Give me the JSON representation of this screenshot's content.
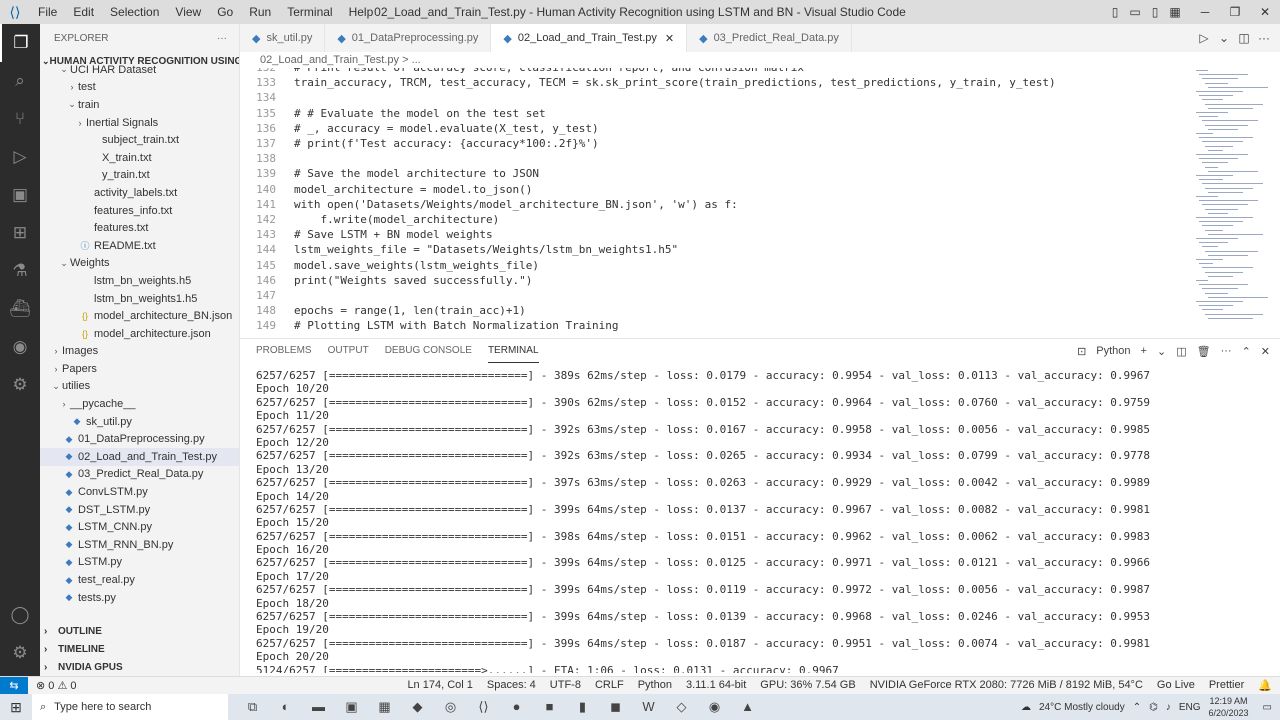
{
  "window": {
    "title": "02_Load_and_Train_Test.py - Human Activity Recognition using LSTM and BN - Visual Studio Code",
    "menu": [
      "File",
      "Edit",
      "Selection",
      "View",
      "Go",
      "Run",
      "Terminal",
      "Help"
    ]
  },
  "sidebar": {
    "header": "EXPLORER",
    "project": "HUMAN ACTIVITY RECOGNITION USING L...",
    "items": [
      {
        "label": "UCI HAR Dataset",
        "type": "folder",
        "open": true,
        "depth": 1
      },
      {
        "label": "test",
        "type": "folder",
        "open": false,
        "depth": 2
      },
      {
        "label": "train",
        "type": "folder",
        "open": true,
        "depth": 2
      },
      {
        "label": "Inertial Signals",
        "type": "folder",
        "open": false,
        "depth": 3
      },
      {
        "label": "subject_train.txt",
        "type": "file",
        "depth": 3
      },
      {
        "label": "X_train.txt",
        "type": "file",
        "depth": 3
      },
      {
        "label": "y_train.txt",
        "type": "file",
        "depth": 3
      },
      {
        "label": "activity_labels.txt",
        "type": "file",
        "depth": 2
      },
      {
        "label": "features_info.txt",
        "type": "file",
        "depth": 2
      },
      {
        "label": "features.txt",
        "type": "file",
        "depth": 2
      },
      {
        "label": "README.txt",
        "type": "info",
        "depth": 2
      },
      {
        "label": "Weights",
        "type": "folder",
        "open": true,
        "depth": 1
      },
      {
        "label": "lstm_bn_weights.h5",
        "type": "file",
        "depth": 2
      },
      {
        "label": "lstm_bn_weights1.h5",
        "type": "file",
        "depth": 2
      },
      {
        "label": "model_architecture_BN.json",
        "type": "json",
        "depth": 2
      },
      {
        "label": "model_architecture.json",
        "type": "json",
        "depth": 2
      },
      {
        "label": "Images",
        "type": "folder",
        "open": false,
        "depth": 0
      },
      {
        "label": "Papers",
        "type": "folder",
        "open": false,
        "depth": 0
      },
      {
        "label": "utilies",
        "type": "folder",
        "open": true,
        "depth": 0
      },
      {
        "label": "__pycache__",
        "type": "folder",
        "open": false,
        "depth": 1
      },
      {
        "label": "sk_util.py",
        "type": "py",
        "depth": 1
      },
      {
        "label": "01_DataPreprocessing.py",
        "type": "py",
        "depth": 0
      },
      {
        "label": "02_Load_and_Train_Test.py",
        "type": "py",
        "depth": 0,
        "selected": true
      },
      {
        "label": "03_Predict_Real_Data.py",
        "type": "py",
        "depth": 0
      },
      {
        "label": "ConvLSTM.py",
        "type": "py",
        "depth": 0
      },
      {
        "label": "DST_LSTM.py",
        "type": "py",
        "depth": 0
      },
      {
        "label": "LSTM_CNN.py",
        "type": "py",
        "depth": 0
      },
      {
        "label": "LSTM_RNN_BN.py",
        "type": "py",
        "depth": 0
      },
      {
        "label": "LSTM.py",
        "type": "py",
        "depth": 0
      },
      {
        "label": "test_real.py",
        "type": "py",
        "depth": 0
      },
      {
        "label": "tests.py",
        "type": "py",
        "depth": 0
      }
    ],
    "sections": [
      "OUTLINE",
      "TIMELINE",
      "NVIDIA GPUS"
    ]
  },
  "tabs": [
    {
      "label": "sk_util.py",
      "active": false
    },
    {
      "label": "01_DataPreprocessing.py",
      "active": false
    },
    {
      "label": "02_Load_and_Train_Test.py",
      "active": true
    },
    {
      "label": "03_Predict_Real_Data.py",
      "active": false
    }
  ],
  "breadcrumb": "02_Load_and_Train_Test.py > ...",
  "editor": {
    "lines": [
      {
        "n": "132",
        "text": "# Print result of accuracy score, classification report, and confusion matrix"
      },
      {
        "n": "133",
        "text": "train_accuracy, TRCM, test_accuracy, TECM = sk.sk_print_score(train_predictions, test_predictions, y_train, y_test)"
      },
      {
        "n": "134",
        "text": ""
      },
      {
        "n": "135",
        "text": "# # Evaluate the model on the test set"
      },
      {
        "n": "136",
        "text": "# _, accuracy = model.evaluate(X_test, y_test)"
      },
      {
        "n": "137",
        "text": "# print(f'Test accuracy: {accuracy*100:.2f}%')"
      },
      {
        "n": "138",
        "text": ""
      },
      {
        "n": "139",
        "text": "# Save the model architecture to JSON"
      },
      {
        "n": "140",
        "text": "model_architecture = model.to_json()"
      },
      {
        "n": "141",
        "text": "with open('Datasets/Weights/model_architecture_BN.json', 'w') as f:"
      },
      {
        "n": "142",
        "text": "    f.write(model_architecture)"
      },
      {
        "n": "143",
        "text": "# Save LSTM + BN model weights"
      },
      {
        "n": "144",
        "text": "lstm_weights_file = \"Datasets/Weights/lstm_bn_weights1.h5\""
      },
      {
        "n": "145",
        "text": "model.save_weights(lstm_weights_file)"
      },
      {
        "n": "146",
        "text": "print(\"Weights saved successfully.\")"
      },
      {
        "n": "147",
        "text": ""
      },
      {
        "n": "148",
        "text": "epochs = range(1, len(train_acc)+1)"
      },
      {
        "n": "149",
        "text": "# Plotting LSTM with Batch Normalization Training"
      }
    ]
  },
  "panel": {
    "tabs": [
      "PROBLEMS",
      "OUTPUT",
      "DEBUG CONSOLE",
      "TERMINAL"
    ],
    "active_tab": "TERMINAL",
    "shell": "Python",
    "lines": [
      "6257/6257 [==============================] - 389s 62ms/step - loss: 0.0179 - accuracy: 0.9954 - val_loss: 0.0113 - val_accuracy: 0.9967",
      "Epoch 10/20",
      "6257/6257 [==============================] - 390s 62ms/step - loss: 0.0152 - accuracy: 0.9964 - val_loss: 0.0760 - val_accuracy: 0.9759",
      "Epoch 11/20",
      "6257/6257 [==============================] - 392s 63ms/step - loss: 0.0167 - accuracy: 0.9958 - val_loss: 0.0056 - val_accuracy: 0.9985",
      "Epoch 12/20",
      "6257/6257 [==============================] - 392s 63ms/step - loss: 0.0265 - accuracy: 0.9934 - val_loss: 0.0799 - val_accuracy: 0.9778",
      "Epoch 13/20",
      "6257/6257 [==============================] - 397s 63ms/step - loss: 0.0263 - accuracy: 0.9929 - val_loss: 0.0042 - val_accuracy: 0.9989",
      "Epoch 14/20",
      "6257/6257 [==============================] - 399s 64ms/step - loss: 0.0137 - accuracy: 0.9967 - val_loss: 0.0082 - val_accuracy: 0.9981",
      "Epoch 15/20",
      "6257/6257 [==============================] - 398s 64ms/step - loss: 0.0151 - accuracy: 0.9962 - val_loss: 0.0062 - val_accuracy: 0.9983",
      "Epoch 16/20",
      "6257/6257 [==============================] - 399s 64ms/step - loss: 0.0125 - accuracy: 0.9971 - val_loss: 0.0121 - val_accuracy: 0.9966",
      "Epoch 17/20",
      "6257/6257 [==============================] - 399s 64ms/step - loss: 0.0119 - accuracy: 0.9972 - val_loss: 0.0056 - val_accuracy: 0.9987",
      "Epoch 18/20",
      "6257/6257 [==============================] - 399s 64ms/step - loss: 0.0139 - accuracy: 0.9968 - val_loss: 0.0246 - val_accuracy: 0.9953",
      "Epoch 19/20",
      "6257/6257 [==============================] - 399s 64ms/step - loss: 0.0187 - accuracy: 0.9951 - val_loss: 0.0074 - val_accuracy: 0.9981",
      "Epoch 20/20",
      "5124/6257 [=======================>......] - ETA: 1:06 - loss: 0.0131 - accuracy: 0.9967"
    ]
  },
  "statusbar": {
    "errors": "0",
    "warnings": "0",
    "position": "Ln 174, Col 1",
    "spaces": "Spaces: 4",
    "encoding": "UTF-8",
    "eol": "CRLF",
    "language": "Python",
    "interpreter": "3.11.1 64-bit",
    "gpu": "GPU: 36% 7.54 GB",
    "gpu_name": "NVIDIA GeForce RTX 2080: 7726 MiB / 8192 MiB, 54°C",
    "golive": "Go Live",
    "prettier": "Prettier"
  },
  "taskbar": {
    "search_placeholder": "Type here to search",
    "weather": "24°C  Mostly cloudy",
    "lang": "ENG",
    "time": "12:19 AM",
    "date": "6/20/2023"
  }
}
